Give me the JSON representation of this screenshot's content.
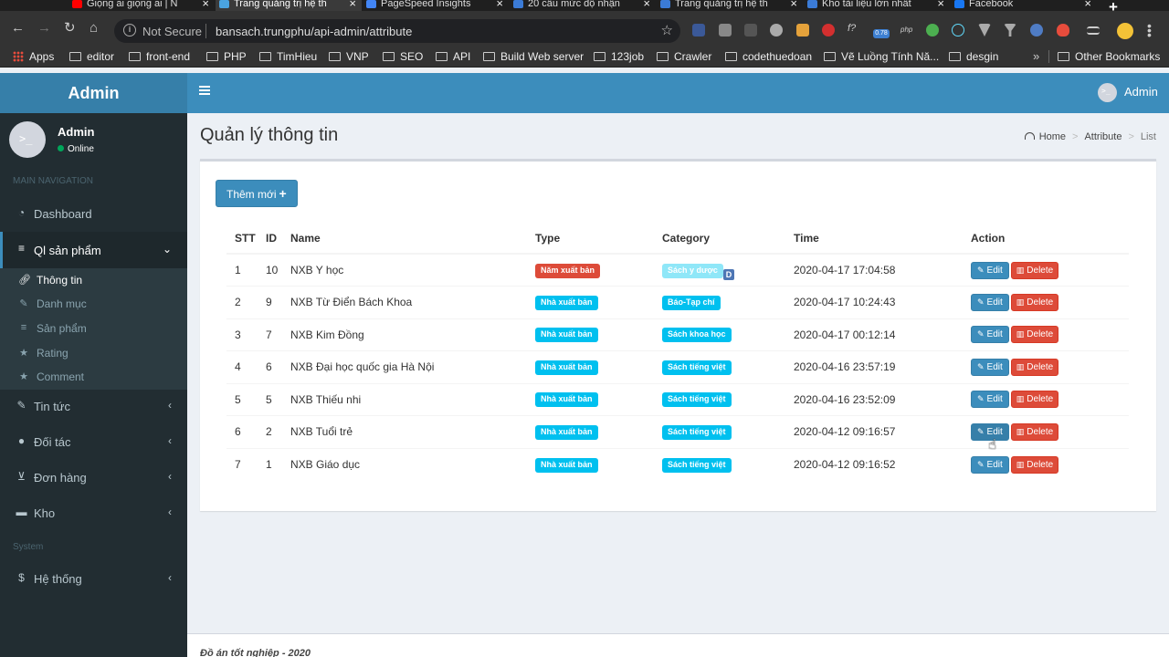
{
  "browser": {
    "tabs": [
      {
        "title": "Giọng ai giọng ai | N",
        "favicon_color": "#ff0000",
        "active": false
      },
      {
        "title": "Trang quảng trị hệ th",
        "favicon_color": "#4aa3df",
        "active": true
      },
      {
        "title": "PageSpeed Insights",
        "favicon_color": "#4285f4",
        "active": false
      },
      {
        "title": "20 câu mức độ nhận",
        "favicon_color": "#3b7bd6",
        "active": false
      },
      {
        "title": "Trang quảng trị hệ th",
        "favicon_color": "#3b7bd6",
        "active": false
      },
      {
        "title": "Kho tài liệu lớn nhất",
        "favicon_color": "#3b7bd6",
        "active": false
      },
      {
        "title": "Facebook",
        "favicon_color": "#1877f2",
        "active": false
      }
    ],
    "new_tab": "+",
    "address": {
      "security": "Not Secure",
      "url": "bansach.trungphu/api-admin/attribute"
    },
    "extensions": [
      {
        "name": "d-icon",
        "color": "#3b5998"
      },
      {
        "name": "camera-icon",
        "color": "#888888"
      },
      {
        "name": "recycle-icon",
        "color": "#555555"
      },
      {
        "name": "gear-icon",
        "color": "#aaaaaa"
      },
      {
        "name": "seo-icon",
        "color": "#e5a23b"
      },
      {
        "name": "stop-icon",
        "color": "#d32f2f"
      },
      {
        "name": "fx-icon",
        "color": "#333333"
      },
      {
        "name": "speed-icon",
        "color": "#3d7fd1"
      },
      {
        "name": "php-icon",
        "color": "#333333"
      },
      {
        "name": "leaf-icon",
        "color": "#4caf50"
      },
      {
        "name": "react-icon",
        "color": "#61dafb"
      },
      {
        "name": "vue-icon",
        "color": "#aaaaaa"
      },
      {
        "name": "funnel-icon",
        "color": "#aaaaaa"
      },
      {
        "name": "circle-icon",
        "color": "#4f7cc4"
      },
      {
        "name": "fire-icon",
        "color": "#e74c3c"
      }
    ],
    "extension_texts": {
      "fx": "f?",
      "speed": "0.78",
      "php": "php"
    },
    "bookmarks": [
      "Apps",
      "editor",
      "front-end",
      "PHP",
      "TimHieu",
      "VNP",
      "SEO",
      "API",
      "Build Web server",
      "123job",
      "Crawler",
      "codethuedoan",
      "Vẽ Luồng Tính Nă...",
      "desgin"
    ],
    "bookmarks_more": "»",
    "other_bookmarks": "Other Bookmarks"
  },
  "app": {
    "logo": "Admin",
    "header_user": "Admin",
    "sidebar": {
      "user_name": "Admin",
      "user_status": "Online",
      "section_main": "MAIN NAVIGATION",
      "section_system": "System",
      "items": [
        {
          "label": "Dashboard",
          "icon": "dashboard-icon"
        },
        {
          "label": "Ql sản phẩm",
          "icon": "database-icon"
        },
        {
          "label": "Tin tức",
          "icon": "edit-icon"
        },
        {
          "label": "Đối tác",
          "icon": "user-icon"
        },
        {
          "label": "Đơn hàng",
          "icon": "cart-icon"
        },
        {
          "label": "Kho",
          "icon": "truck-icon"
        },
        {
          "label": "Hệ thống",
          "icon": "dollar-icon"
        }
      ],
      "submenu": [
        {
          "label": "Thông tin",
          "icon": "link-icon"
        },
        {
          "label": "Danh mục",
          "icon": "edit-icon"
        },
        {
          "label": "Sản phẩm",
          "icon": "database-icon"
        },
        {
          "label": "Rating",
          "icon": "star-icon"
        },
        {
          "label": "Comment",
          "icon": "star-icon"
        }
      ]
    },
    "page_title": "Quản lý thông tin",
    "breadcrumb": [
      "Home",
      "Attribute",
      "List"
    ],
    "add_button": "Thêm mới",
    "table": {
      "headers": [
        "STT",
        "ID",
        "Name",
        "Type",
        "Category",
        "Time",
        "Action"
      ],
      "rows": [
        {
          "stt": "1",
          "id": "10",
          "name": "NXB Y học",
          "type": "Năm xuất bản",
          "type_color": "#dd4b39",
          "category": "Sách y dược",
          "time": "2020-04-17 17:04:58"
        },
        {
          "stt": "2",
          "id": "9",
          "name": "NXB Từ Điển Bách Khoa",
          "type": "Nhà xuất bản",
          "type_color": "#00c0ef",
          "category": "Báo-Tạp chí",
          "time": "2020-04-17 10:24:43"
        },
        {
          "stt": "3",
          "id": "7",
          "name": "NXB Kim Đồng",
          "type": "Nhà xuất bản",
          "type_color": "#00c0ef",
          "category": "Sách khoa học",
          "time": "2020-04-17 00:12:14"
        },
        {
          "stt": "4",
          "id": "6",
          "name": "NXB Đại học quốc gia Hà Nội",
          "type": "Nhà xuất bản",
          "type_color": "#00c0ef",
          "category": "Sách tiếng việt",
          "time": "2020-04-16 23:57:19"
        },
        {
          "stt": "5",
          "id": "5",
          "name": "NXB Thiếu nhi",
          "type": "Nhà xuất bản",
          "type_color": "#00c0ef",
          "category": "Sách tiếng việt",
          "time": "2020-04-16 23:52:09"
        },
        {
          "stt": "6",
          "id": "2",
          "name": "NXB Tuổi trẻ",
          "type": "Nhà xuất bản",
          "type_color": "#00c0ef",
          "category": "Sách tiếng việt",
          "time": "2020-04-12 09:16:57"
        },
        {
          "stt": "7",
          "id": "1",
          "name": "NXB Giáo dục",
          "type": "Nhà xuất bản",
          "type_color": "#00c0ef",
          "category": "Sách tiếng việt",
          "time": "2020-04-12 09:16:52"
        }
      ],
      "edit_label": "Edit",
      "delete_label": "Delete",
      "category_overlay_badge": "D"
    },
    "footer": "Đồ án tốt nghiệp - 2020",
    "colors": {
      "primary": "#3c8dbc",
      "sidebar": "#222d32",
      "danger": "#dd4b39",
      "info": "#00c0ef"
    }
  }
}
